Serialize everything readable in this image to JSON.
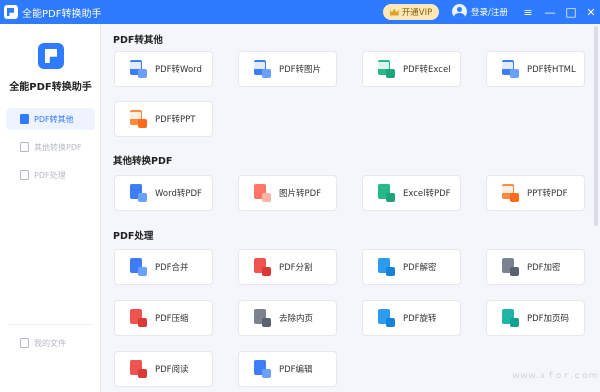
{
  "app": {
    "title": "全能PDF转换助手",
    "brand_color": "#2f7bff"
  },
  "titlebar": {
    "vip_label": "开通VIP",
    "login_label": "登录/注册",
    "minimize_glyph": "—",
    "maximize_glyph": "□",
    "close_glyph": "✕"
  },
  "sidebar": {
    "app_name": "全能PDF转换助手",
    "items": [
      {
        "label": "PDF转其他",
        "active": true,
        "icon": "pdf-doc-icon"
      },
      {
        "label": "其他转换PDF",
        "active": false,
        "icon": "doc-icon"
      },
      {
        "label": "PDF处理",
        "active": false,
        "icon": "doc-icon"
      }
    ],
    "my_files": "我的文件"
  },
  "sections": [
    {
      "title": "PDF转其他",
      "cards": [
        {
          "label": "PDF转Word",
          "icon": "pdf-to-word-icon"
        },
        {
          "label": "PDF转图片",
          "icon": "pdf-to-image-icon"
        },
        {
          "label": "PDF转Excel",
          "icon": "pdf-to-excel-icon"
        },
        {
          "label": "PDF转HTML",
          "icon": "pdf-to-html-icon"
        },
        {
          "label": "PDF转PPT",
          "icon": "pdf-to-ppt-icon"
        }
      ]
    },
    {
      "title": "其他转换PDF",
      "cards": [
        {
          "label": "Word转PDF",
          "icon": "word-to-pdf-icon"
        },
        {
          "label": "图片转PDF",
          "icon": "image-to-pdf-icon"
        },
        {
          "label": "Excel转PDF",
          "icon": "excel-to-pdf-icon"
        },
        {
          "label": "PPT转PDF",
          "icon": "ppt-to-pdf-icon"
        }
      ]
    },
    {
      "title": "PDF处理",
      "cards": [
        {
          "label": "PDF合并",
          "icon": "pdf-merge-icon"
        },
        {
          "label": "PDF分割",
          "icon": "pdf-split-icon"
        },
        {
          "label": "PDF解密",
          "icon": "pdf-decrypt-icon"
        },
        {
          "label": "PDF加密",
          "icon": "pdf-encrypt-icon"
        },
        {
          "label": "PDF压缩",
          "icon": "pdf-compress-icon"
        },
        {
          "label": "去除内页",
          "icon": "remove-pages-icon"
        },
        {
          "label": "PDF旋转",
          "icon": "pdf-rotate-icon"
        },
        {
          "label": "PDF加页码",
          "icon": "pdf-page-number-icon"
        },
        {
          "label": "PDF阅读",
          "icon": "pdf-read-icon"
        },
        {
          "label": "PDF编辑",
          "icon": "pdf-edit-icon"
        }
      ]
    }
  ],
  "watermark": "ｗｗｗ.ｘｆｏｒ.ｃｏｍ"
}
